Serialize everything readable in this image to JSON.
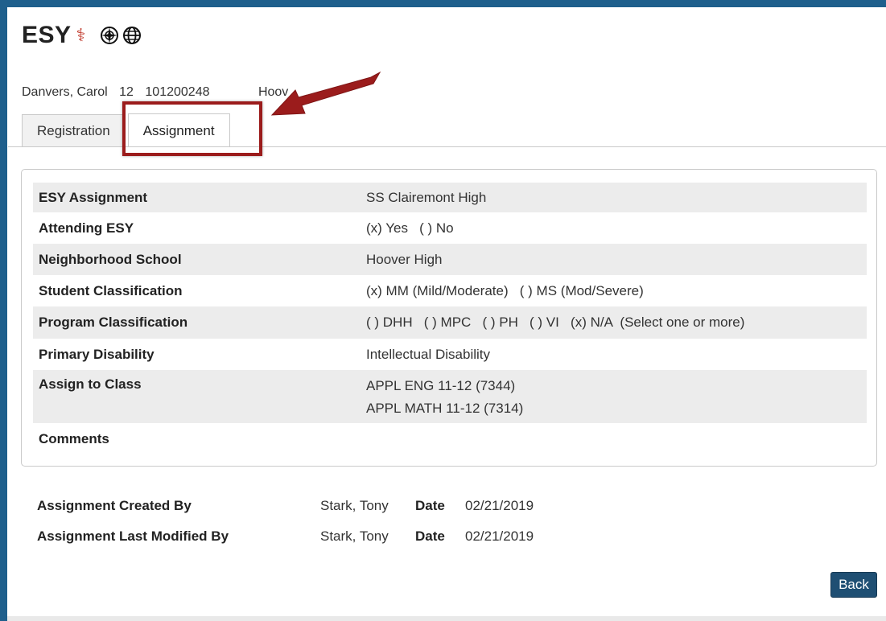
{
  "header": {
    "title": "ESY",
    "caduceus_icon": "caduceus-icon",
    "icons": [
      "compass-globe-icon",
      "globe-icon"
    ]
  },
  "student": {
    "name": "Danvers, Carol",
    "grade": "12",
    "id": "101200248",
    "school_partial": "Hoov"
  },
  "tabs": [
    {
      "label": "Registration",
      "active": false
    },
    {
      "label": "Assignment",
      "active": true
    }
  ],
  "assignment": {
    "rows": [
      {
        "label": "ESY Assignment",
        "value": [
          "SS Clairemont High"
        ]
      },
      {
        "label": "Attending ESY",
        "value": [
          "(x) Yes   ( ) No"
        ]
      },
      {
        "label": "Neighborhood School",
        "value": [
          "Hoover High"
        ]
      },
      {
        "label": "Student Classification",
        "value": [
          "(x) MM (Mild/Moderate)   ( ) MS (Mod/Severe)"
        ]
      },
      {
        "label": "Program Classification",
        "value": [
          "( ) DHH   ( ) MPC   ( ) PH   ( ) VI   (x) N/A  (Select one or more)"
        ]
      },
      {
        "label": "Primary Disability",
        "value": [
          "Intellectual Disability"
        ]
      },
      {
        "label": "Assign to Class",
        "value": [
          "APPL ENG 11-12 (7344)",
          "APPL MATH 11-12 (7314)"
        ]
      },
      {
        "label": "Comments",
        "value": [
          ""
        ]
      }
    ]
  },
  "audit": {
    "created": {
      "label": "Assignment Created By",
      "name": "Stark, Tony",
      "date_label": "Date",
      "date": "02/21/2019"
    },
    "modified": {
      "label": "Assignment Last Modified By",
      "name": "Stark, Tony",
      "date_label": "Date",
      "date": "02/21/2019"
    }
  },
  "actions": {
    "back_label": "Back"
  },
  "colors": {
    "frame": "#1f5f8c",
    "annotation": "#9b1c1c",
    "button": "#1f4f73",
    "row_shade": "#ececec"
  }
}
